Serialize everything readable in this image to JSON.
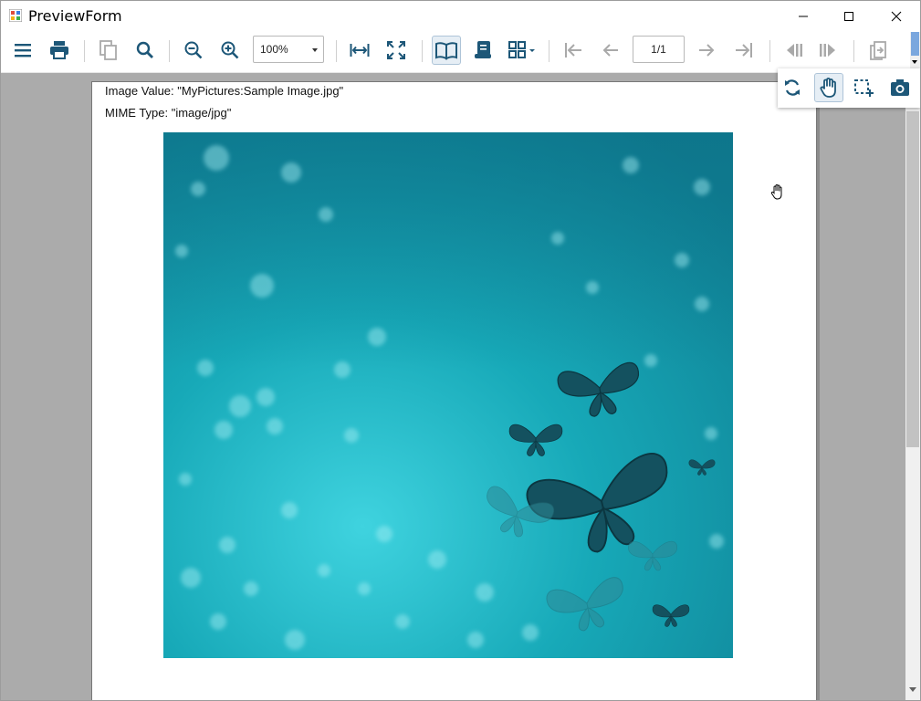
{
  "window": {
    "title": "PreviewForm"
  },
  "title_buttons": {
    "minimize": "minimize-icon",
    "maximize": "maximize-icon",
    "close": "close-icon"
  },
  "toolbar": {
    "menu_icon": "hamburger-menu-icon",
    "print_icon": "print-icon",
    "copy_icon": "copy-icon",
    "find_icon": "search-icon",
    "zoom_out_icon": "zoom-out-icon",
    "zoom_in_icon": "zoom-in-icon",
    "zoom_value": "100%",
    "fit_width_icon": "fit-width-icon",
    "full_screen_icon": "full-screen-icon",
    "single_page_icon": "book-icon",
    "continuous_icon": "scroll-icon",
    "multi_page_icon": "grid-icon",
    "first_page_icon": "first-page-icon",
    "prev_page_icon": "previous-page-icon",
    "page_value": "1/1",
    "next_page_icon": "next-page-icon",
    "last_page_icon": "last-page-icon",
    "history_back_icon": "history-back-icon",
    "history_forward_icon": "history-forward-icon",
    "exit_icon": "exit-icon"
  },
  "popup_tools": {
    "refresh_icon": "refresh-icon",
    "hand_icon": "hand-tool-icon",
    "selection_icon": "selection-icon",
    "snapshot_icon": "camera-icon"
  },
  "document": {
    "image_value_label": "Image Value: \"MyPictures:Sample Image.jpg\"",
    "mime_type_label": "MIME Type: \"image/jpg\""
  },
  "colors": {
    "icon": "#1d5778",
    "disabled_icon": "#a9a9a9",
    "viewer_bg": "#ababab"
  }
}
